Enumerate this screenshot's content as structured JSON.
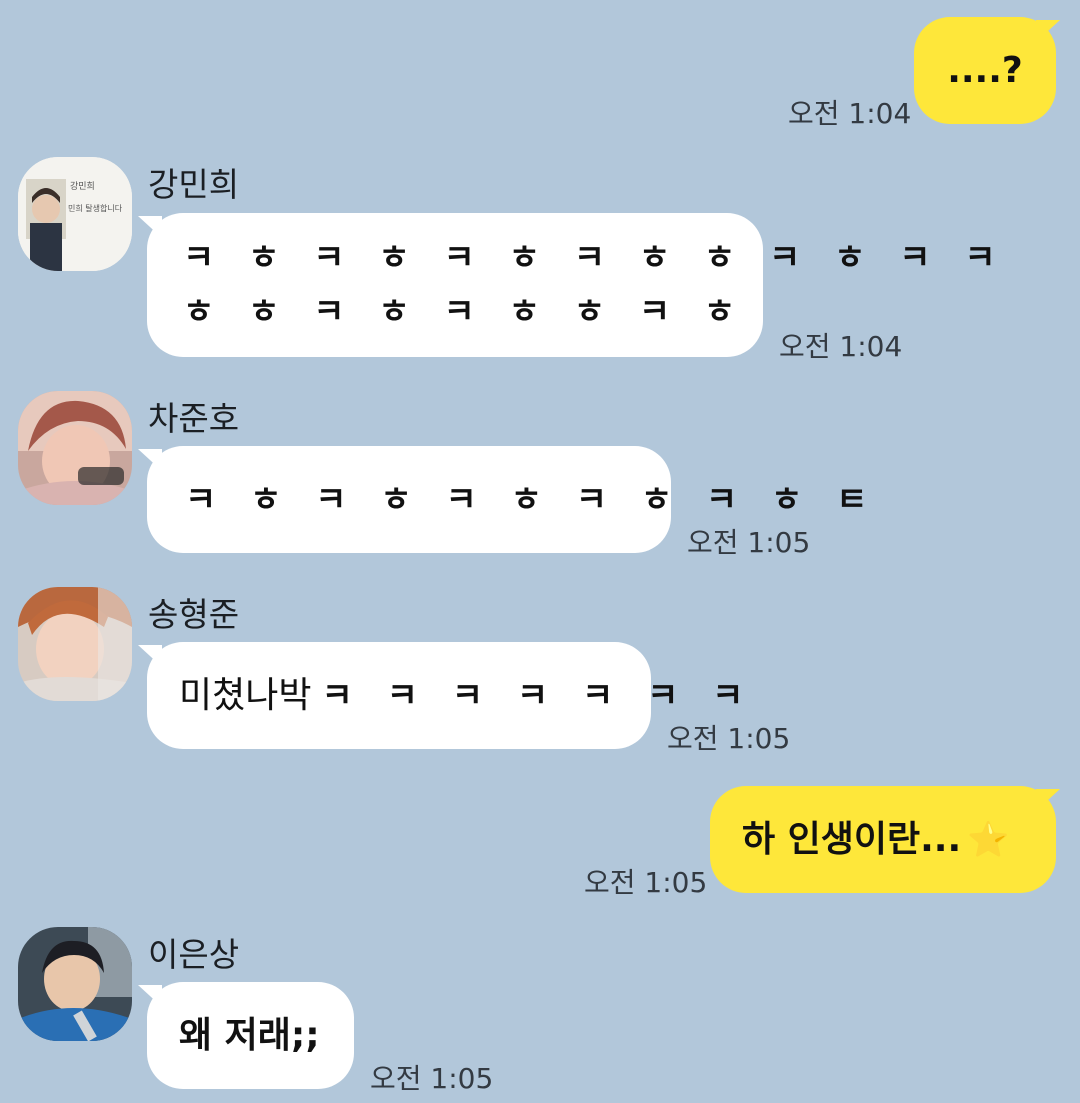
{
  "messages": [
    {
      "id": "m1",
      "side": "right",
      "text": "....?",
      "time": "오전 1:04"
    },
    {
      "id": "m2",
      "side": "left",
      "sender": "강민희",
      "lines": [
        "ㅋ ㅎ ㅋ ㅎ ㅋ ㅎ ㅋ ㅎ ㅎ ㅋ ㅎ ㅋ ㅋ",
        "ㅎ ㅎ ㅋ ㅎ ㅋ ㅎ ㅎ ㅋ ㅎ"
      ],
      "time": "오전 1:04",
      "avatar_text": [
        "강민희",
        "민희 탈생합니다"
      ]
    },
    {
      "id": "m3",
      "side": "left",
      "sender": "차준호",
      "text": "ㅋ ㅎ ㅋ ㅎ ㅋ ㅎ ㅋ ㅎ ㅋ ㅎ ㅌ",
      "time": "오전 1:05"
    },
    {
      "id": "m4",
      "side": "left",
      "sender": "송형준",
      "text_main": "미쳤나박",
      "text_tail": "ㅋ ㅋ ㅋ ㅋ ㅋ ㅋ ㅋ",
      "time": "오전 1:05"
    },
    {
      "id": "m5",
      "side": "right",
      "text": "하 인생이란...",
      "emoji": "⭐",
      "time": "오전 1:05"
    },
    {
      "id": "m6",
      "side": "left",
      "sender": "이은상",
      "text": "왜 저래;;",
      "time": "오전 1:05"
    }
  ],
  "colors": {
    "background": "#b2c7da",
    "my_bubble": "#fee73a",
    "their_bubble": "#ffffff"
  }
}
